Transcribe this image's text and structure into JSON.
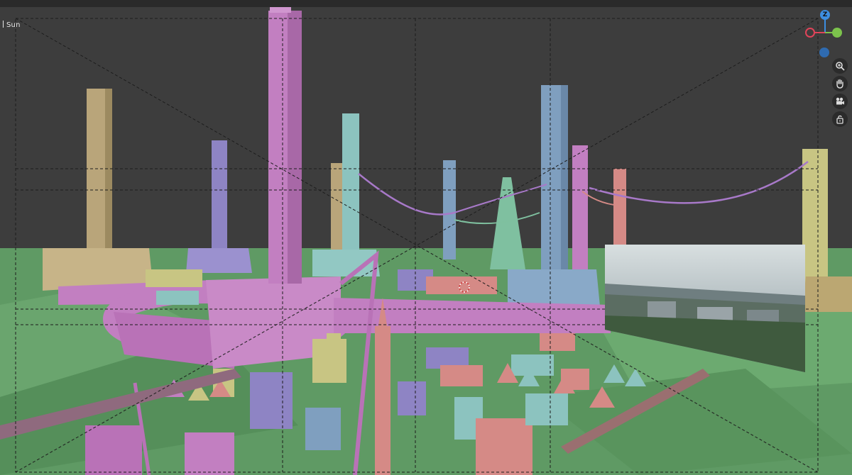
{
  "viewport": {
    "object_label": "Sun",
    "gizmo": {
      "x_label": "",
      "y_label": "",
      "z_label": "Z"
    },
    "tools": [
      {
        "name": "zoom-icon"
      },
      {
        "name": "hand-pan-icon"
      },
      {
        "name": "camera-view-icon"
      },
      {
        "name": "lock-camera-icon"
      }
    ]
  },
  "colors": {
    "background": "#3d3d3d",
    "ground": "#5f9a64",
    "pink": "#c27fc1",
    "blue": "#7f9fbf",
    "teal": "#8cc3bf",
    "tan": "#b9a57a",
    "purple": "#8e84c4",
    "salmon": "#d58a86",
    "yellow": "#c8c583",
    "axis_x": "#e0445a",
    "axis_y": "#7cc34c",
    "axis_z": "#3d8ee0"
  },
  "reference_image": {
    "name": "city-reference-photo"
  }
}
